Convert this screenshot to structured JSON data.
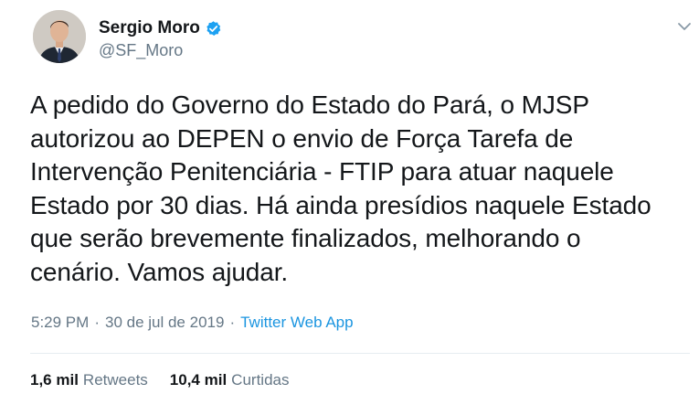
{
  "author": {
    "display_name": "Sergio Moro",
    "handle": "@SF_Moro",
    "verified": true,
    "avatar_icon": "profile-photo"
  },
  "tweet": {
    "text": "A pedido do Governo do Estado do Pará, o MJSP\nautorizou ao DEPEN o envio de Força Tarefa de\nIntervenção Penitenciária - FTIP para atuar naquele\nEstado por 30 dias. Há ainda presídios naquele Estado\nque serão brevemente finalizados, melhorando o\ncenário. Vamos ajudar.",
    "time": "5:29 PM",
    "separator": "·",
    "date": "30 de jul de 2019",
    "source": "Twitter Web App"
  },
  "stats": {
    "retweets_count": "1,6 mil",
    "retweets_label": "Retweets",
    "likes_count": "10,4 mil",
    "likes_label": "Curtidas"
  },
  "colors": {
    "link": "#1b95e0",
    "muted": "#657786",
    "text": "#14171a",
    "verified": "#1da1f2"
  },
  "icons": {
    "verified": "verified-badge-icon",
    "menu": "chevron-down-icon"
  }
}
